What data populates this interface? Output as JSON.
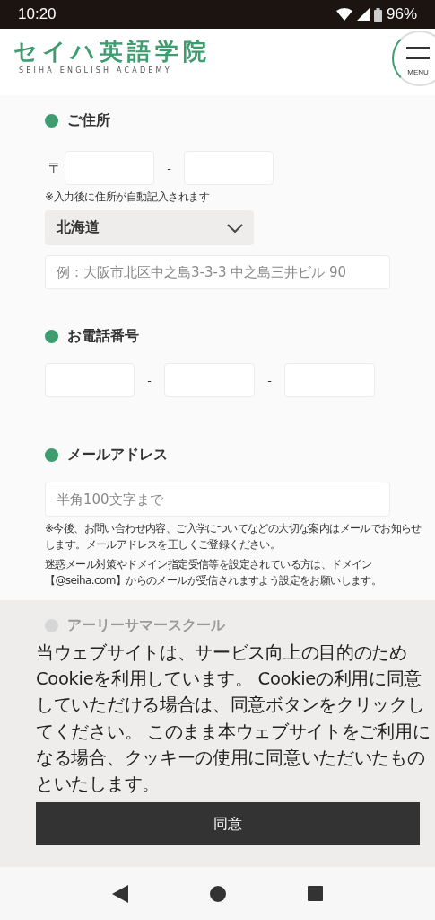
{
  "status_bar": {
    "time": "10:20",
    "battery": "96%"
  },
  "header": {
    "logo": "セイハ英語学院",
    "logo_sub": "SEIHA ENGLISH ACADEMY",
    "menu_label": "MENU"
  },
  "address": {
    "title": "ご住所",
    "postal_mark": "〒",
    "postal_separator": "-",
    "note": "※入力後に住所が自動記入されます",
    "prefecture": "北海道",
    "street_placeholder": "例：大阪市北区中之島3-3-3 中之島三井ビル 90"
  },
  "phone": {
    "title": "お電話番号",
    "separators": [
      "-",
      "-"
    ]
  },
  "email": {
    "title": "メールアドレス",
    "placeholder": "半角100文字まで",
    "notes": [
      "※今後、お問い合わせ内容、ご入学についてなどの大切な案内はメールでお知らせします。メールアドレスを正しくご登録ください。",
      "迷惑メール対策やドメイン指定受信等を設定されている方は、ドメイン【@seiha.com】からのメールが受信されますよう設定をお願いします。"
    ]
  },
  "course": {
    "title": "アーリーサマースクール"
  },
  "cookie_banner": {
    "message": "当ウェブサイトは、サービス向上の目的のためCookieを利用しています。 Cookieの利用に同意していただける場合は、同意ボタンをクリックしてください。 このまま本ウェブサイトをご利用になる場合、クッキーの使用に同意いただいたものといたします。",
    "button": "同意"
  }
}
